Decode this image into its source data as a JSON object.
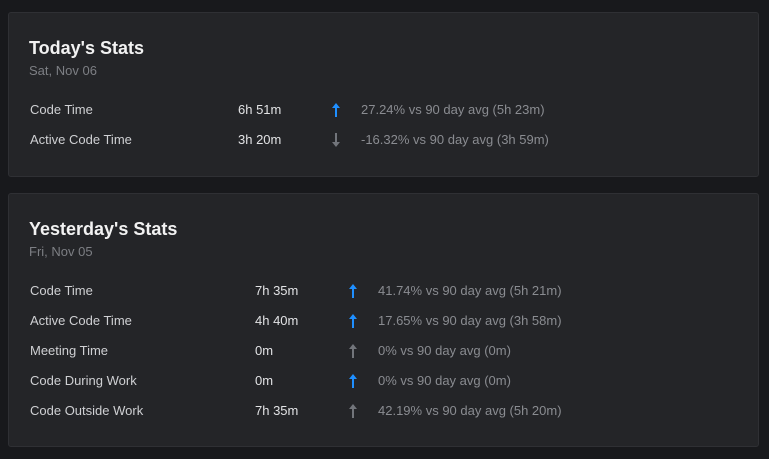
{
  "colors": {
    "background": "#18191c",
    "card": "#242528",
    "arrow_up": "#1f8fff",
    "arrow_neutral": "#72757b"
  },
  "today": {
    "title": "Today's Stats",
    "date": "Sat, Nov 06",
    "rows": [
      {
        "label": "Code Time",
        "value": "6h 51m",
        "arrow": "up",
        "arrow_color": "blue",
        "compare": "27.24% vs 90 day avg (5h 23m)"
      },
      {
        "label": "Active Code Time",
        "value": "3h 20m",
        "arrow": "down",
        "arrow_color": "gray",
        "compare": "-16.32% vs 90 day avg (3h 59m)"
      }
    ]
  },
  "yesterday": {
    "title": "Yesterday's Stats",
    "date": "Fri, Nov 05",
    "rows": [
      {
        "label": "Code Time",
        "value": "7h 35m",
        "arrow": "up",
        "arrow_color": "blue",
        "compare": "41.74% vs 90 day avg (5h 21m)"
      },
      {
        "label": "Active Code Time",
        "value": "4h 40m",
        "arrow": "up",
        "arrow_color": "blue",
        "compare": "17.65% vs 90 day avg (3h 58m)"
      },
      {
        "label": "Meeting Time",
        "value": "0m",
        "arrow": "up",
        "arrow_color": "gray",
        "compare": "0% vs 90 day avg (0m)"
      },
      {
        "label": "Code During Work",
        "value": "0m",
        "arrow": "up",
        "arrow_color": "blue",
        "compare": "0% vs 90 day avg (0m)"
      },
      {
        "label": "Code Outside Work",
        "value": "7h 35m",
        "arrow": "up",
        "arrow_color": "gray",
        "compare": "42.19% vs 90 day avg (5h 20m)"
      }
    ]
  }
}
